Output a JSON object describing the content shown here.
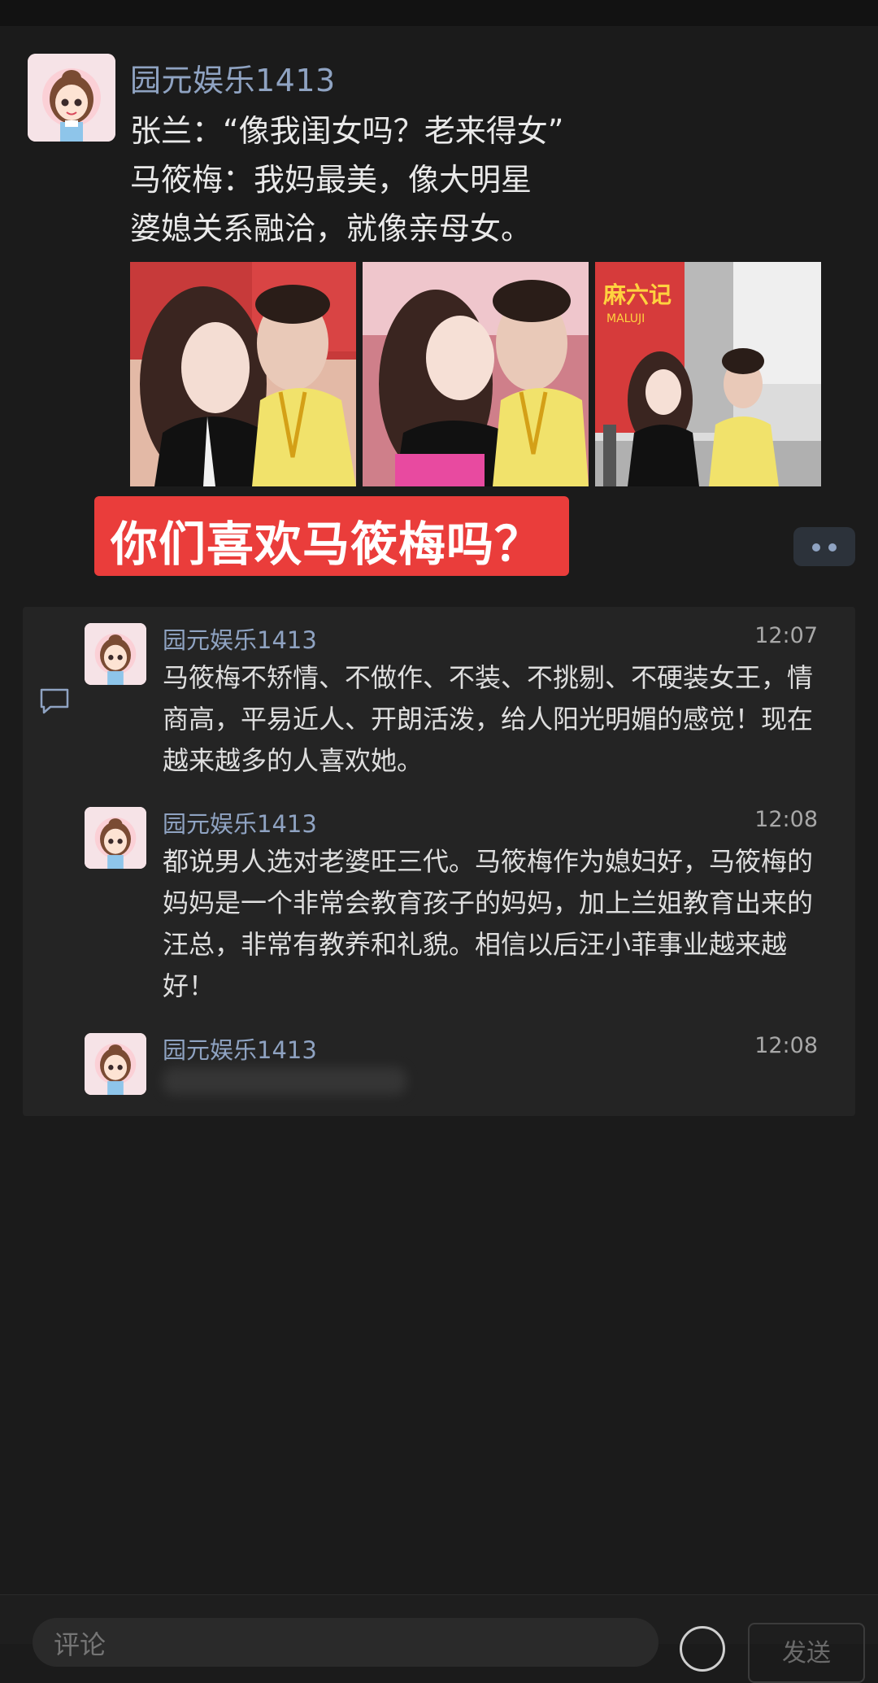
{
  "post": {
    "author": "园元娱乐1413",
    "lines": [
      "张兰：“像我闺女吗？老来得女”",
      "马筱梅：我妈最美，像大明星",
      "婆媳关系融洽，就像亲母女。"
    ],
    "photo_sign_text": "麻六记",
    "photo_sign_sub": "MALUJI",
    "banner": "你们喜欢马筱梅吗？"
  },
  "comments": [
    {
      "author": "园元娱乐1413",
      "time": "12:07",
      "text": "马筱梅不矫情、不做作、不装、不挑剔、不硬装女王，情商高，平易近人、开朗活泼，给人阳光明媚的感觉！现在越来越多的人喜欢她。"
    },
    {
      "author": "园元娱乐1413",
      "time": "12:08",
      "text": "都说男人选对老婆旺三代。马筱梅作为媳妇好，马筱梅的妈妈是一个非常会教育孩子的妈妈，加上兰姐教育出来的汪总，非常有教养和礼貌。相信以后汪小菲事业越来越好！"
    },
    {
      "author": "园元娱乐1413",
      "time": "12:08"
    }
  ],
  "bottom_bar": {
    "input_placeholder": "评论",
    "send_label": "发送"
  },
  "colors": {
    "background": "#1b1b1b",
    "link": "#8fa3c2",
    "banner": "#ea3d3b"
  }
}
